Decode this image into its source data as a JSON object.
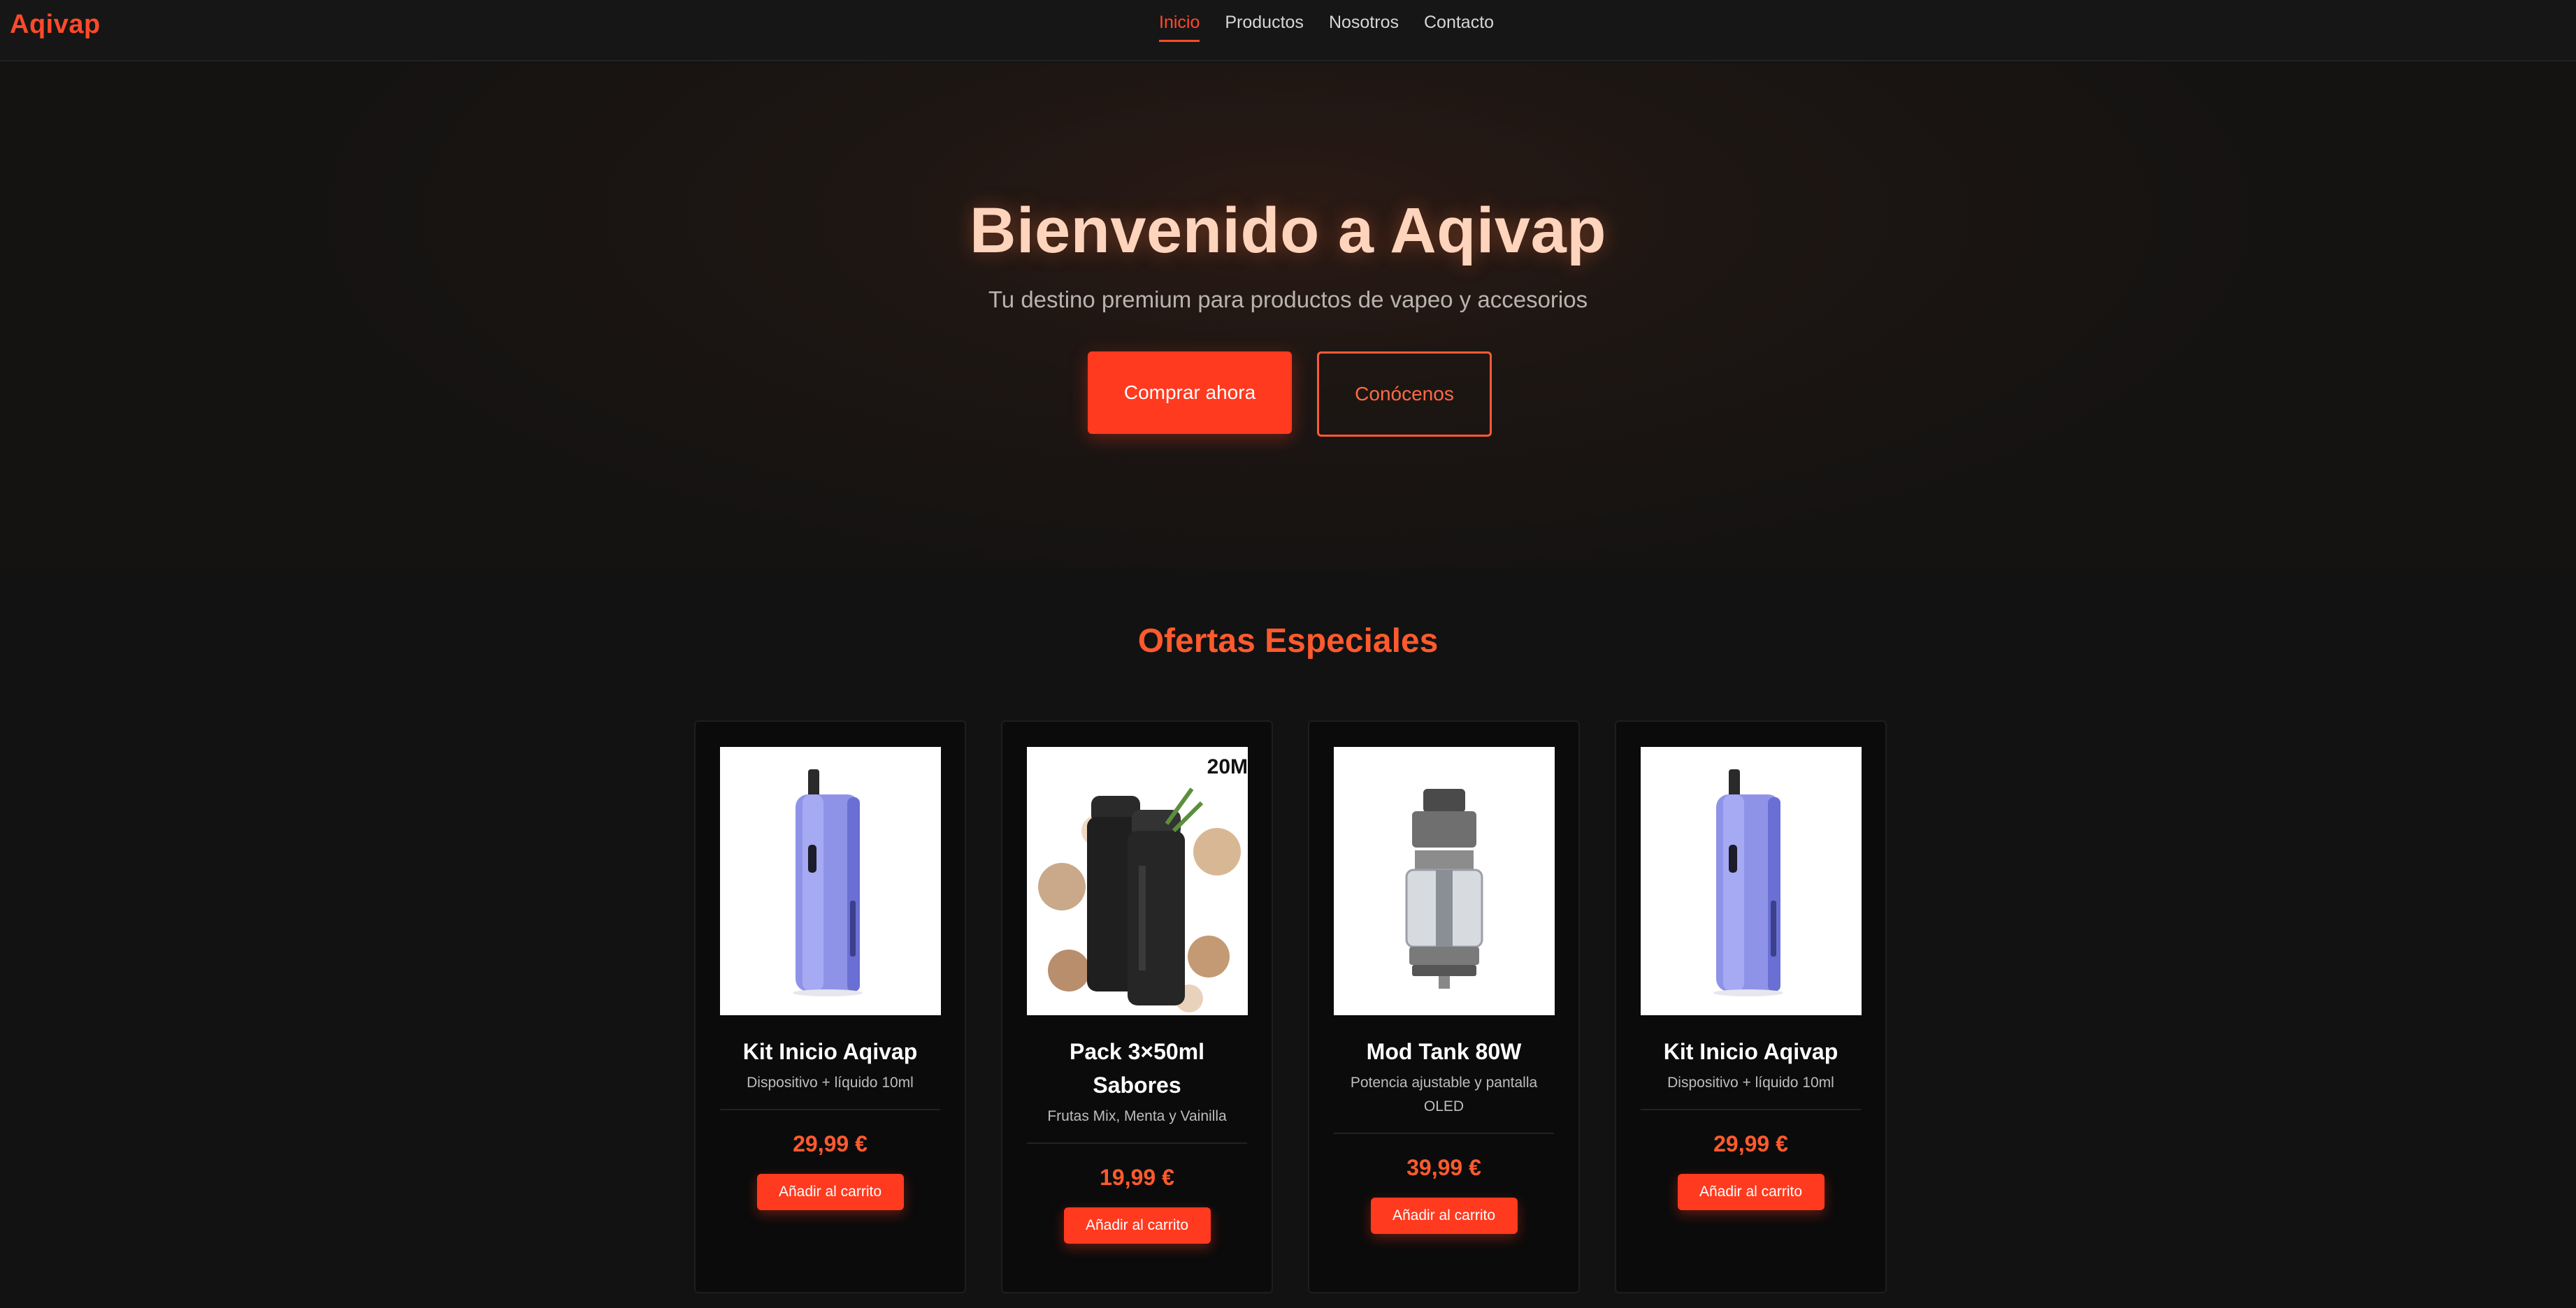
{
  "brand": "Aqivap",
  "nav": {
    "items": [
      {
        "label": "Inicio",
        "active": true
      },
      {
        "label": "Productos",
        "active": false
      },
      {
        "label": "Nosotros",
        "active": false
      },
      {
        "label": "Contacto",
        "active": false
      }
    ]
  },
  "hero": {
    "title": "Bienvenido a Aqivap",
    "subtitle": "Tu destino premium para productos de vapeo y accesorios",
    "primary_button": "Comprar ahora",
    "secondary_button": "Conócenos"
  },
  "offers": {
    "title": "Ofertas Especiales",
    "products": [
      {
        "name": "Kit Inicio Aqivap",
        "desc": "Dispositivo + líquido 10ml",
        "price": "29,99 €",
        "button": "Añadir al carrito",
        "image": "pod-kit-lavender"
      },
      {
        "name": "Pack 3×50ml Sabores",
        "desc": "Frutas Mix, Menta y Vainilla",
        "price": "19,99 €",
        "button": "Añadir al carrito",
        "image": "pods-coconut",
        "badge": "20M"
      },
      {
        "name": "Mod Tank 80W",
        "desc": "Potencia ajustable y pantalla OLED",
        "price": "39,99 €",
        "button": "Añadir al carrito",
        "image": "tank-atomizer"
      },
      {
        "name": "Kit Inicio Aqivap",
        "desc": "Dispositivo + líquido 10ml",
        "price": "29,99 €",
        "button": "Añadir al carrito",
        "image": "pod-kit-lavender"
      }
    ]
  },
  "colors": {
    "accent": "#ff3a1f",
    "accent_text": "#ff5a2e",
    "background": "#121212",
    "card": "#0b0b0b"
  }
}
